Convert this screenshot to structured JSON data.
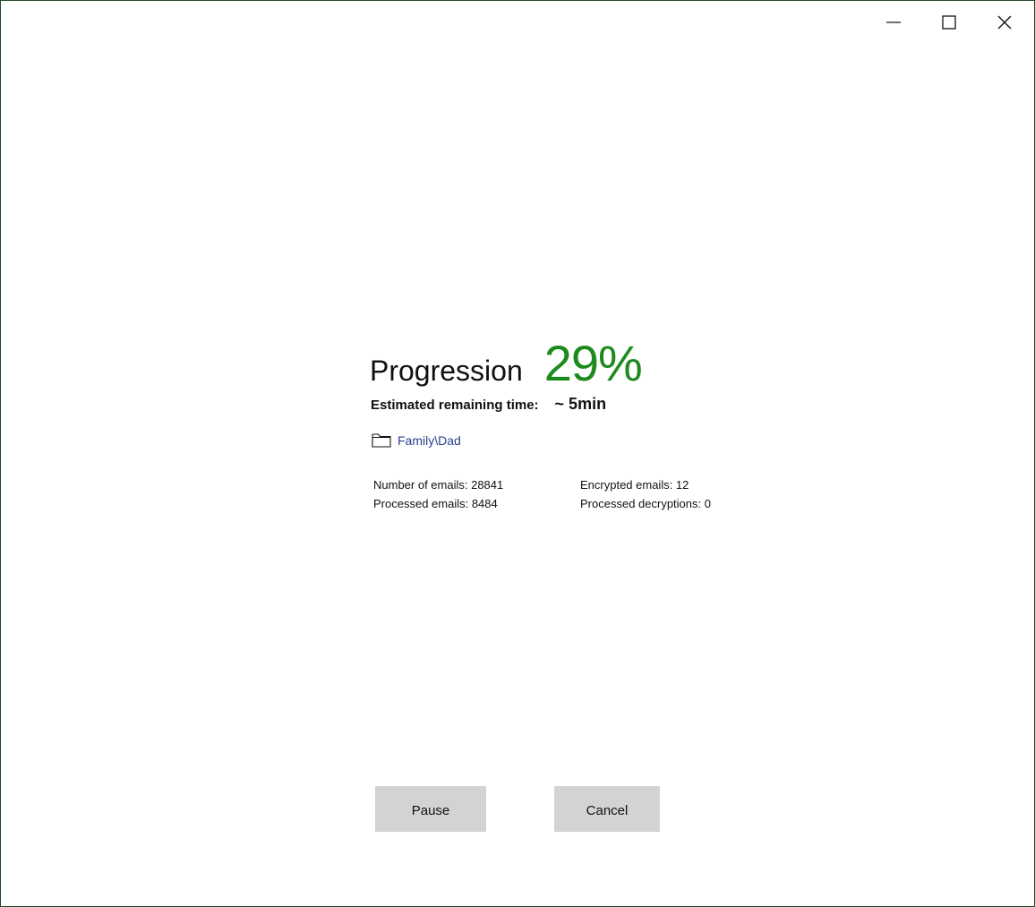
{
  "window": {
    "controls": {
      "minimize_icon": "minimize-icon",
      "maximize_icon": "maximize-icon",
      "close_icon": "close-icon"
    }
  },
  "progress": {
    "label": "Progression",
    "value_text": "29%",
    "value": 29,
    "accent_color": "#1e8a1e"
  },
  "eta": {
    "label": "Estimated remaining time:",
    "value": "~ 5min"
  },
  "folder": {
    "icon": "folder-icon",
    "path": "Family\\Dad",
    "link_color": "#2b3f8f"
  },
  "stats": {
    "number_of_emails": "Number of emails: 28841",
    "processed_emails": "Processed emails: 8484",
    "encrypted_emails": "Encrypted emails: 12",
    "processed_decryptions": "Processed decryptions: 0"
  },
  "actions": {
    "pause_label": "Pause",
    "cancel_label": "Cancel",
    "button_bg": "#d3d3d3"
  }
}
